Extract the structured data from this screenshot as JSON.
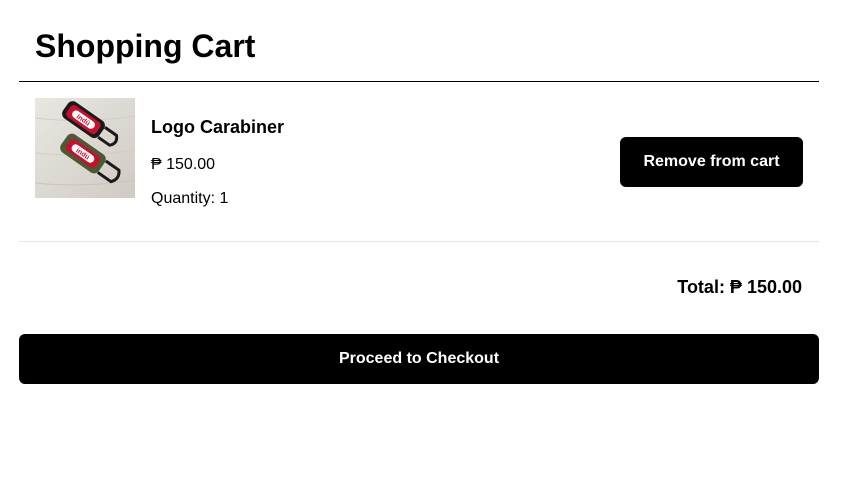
{
  "page": {
    "title": "Shopping Cart"
  },
  "cart": {
    "items": [
      {
        "name": "Logo Carabiner",
        "price": "₱ 150.00",
        "quantity_label": "Quantity: 1",
        "remove_label": "Remove from cart",
        "image_text": "indü"
      }
    ],
    "total_label": "Total: ₱ 150.00"
  },
  "checkout": {
    "label": "Proceed to Checkout"
  },
  "colors": {
    "button_bg": "#000000",
    "button_text": "#ffffff",
    "divider": "#e6e6e6",
    "strap_red": "#c8102e",
    "strap_green": "#4a5a32",
    "hardware": "#1a1a1a"
  }
}
